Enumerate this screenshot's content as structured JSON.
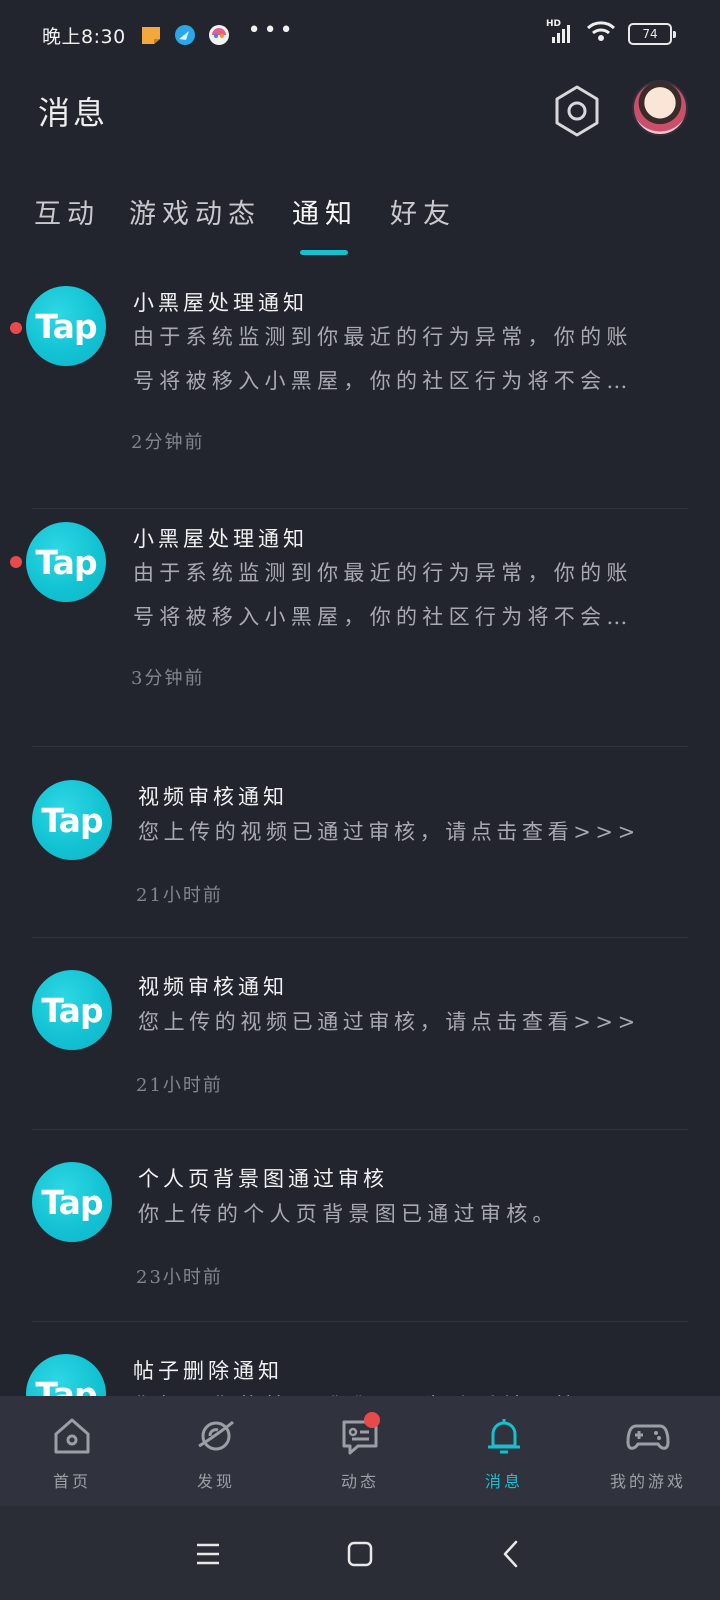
{
  "status_bar": {
    "time": "晚上8:30",
    "apps": [
      "note-app-icon",
      "browser-app-icon",
      "game-center-app-icon"
    ],
    "more": "•••",
    "signal_label": "HD",
    "battery": "74"
  },
  "header": {
    "title": "消息",
    "settings_icon": "hexagon-settings-icon",
    "avatar": "user-avatar"
  },
  "tabs": [
    {
      "label": "互动",
      "active": false
    },
    {
      "label": "游戏动态",
      "active": false
    },
    {
      "label": "通知",
      "active": true
    },
    {
      "label": "好友",
      "active": false
    }
  ],
  "notifications": [
    {
      "logo": "Tap",
      "unread": true,
      "title": "小黑屋处理通知",
      "body_line1": "由于系统监测到你最近的行为异常，你的账",
      "body_line2": "号将被移入小黑屋，你的社区行为将不会…",
      "time": "2分钟前"
    },
    {
      "logo": "Tap",
      "unread": true,
      "title": "小黑屋处理通知",
      "body_line1": "由于系统监测到你最近的行为异常，你的账",
      "body_line2": "号将被移入小黑屋，你的社区行为将不会…",
      "time": "3分钟前"
    },
    {
      "logo": "Tap",
      "unread": false,
      "title": "视频审核通知",
      "body_line1": "您上传的视频已通过审核，请点击查看>>>",
      "time": "21小时前"
    },
    {
      "logo": "Tap",
      "unread": false,
      "title": "视频审核通知",
      "body_line1": "您上传的视频已通过审核，请点击查看>>>",
      "time": "21小时前"
    },
    {
      "logo": "Tap",
      "unread": false,
      "title": "个人页背景图通过审核",
      "body_line1": "你上传的个人页背景图已通过审核。",
      "time": "23小时前"
    },
    {
      "logo": "Tap",
      "unread": false,
      "title": "帖子删除通知",
      "body_line1": "你好，你的帖子《 》，因为违反社区管理"
    }
  ],
  "bottom_nav": [
    {
      "label": "首页",
      "icon": "home-icon",
      "active": false,
      "badge": false
    },
    {
      "label": "发现",
      "icon": "planet-icon",
      "active": false,
      "badge": false
    },
    {
      "label": "动态",
      "icon": "chat-bubble-icon",
      "active": false,
      "badge": true
    },
    {
      "label": "消息",
      "icon": "bell-icon",
      "active": true,
      "badge": false
    },
    {
      "label": "我的游戏",
      "icon": "gamepad-icon",
      "active": false,
      "badge": false
    }
  ],
  "system_nav": [
    "menu-icon",
    "home-square-icon",
    "back-chevron-icon"
  ],
  "colors": {
    "background": "#23252e",
    "accent": "#14c1d0",
    "unread": "#e84a4a",
    "nav_bg": "#30333e"
  }
}
